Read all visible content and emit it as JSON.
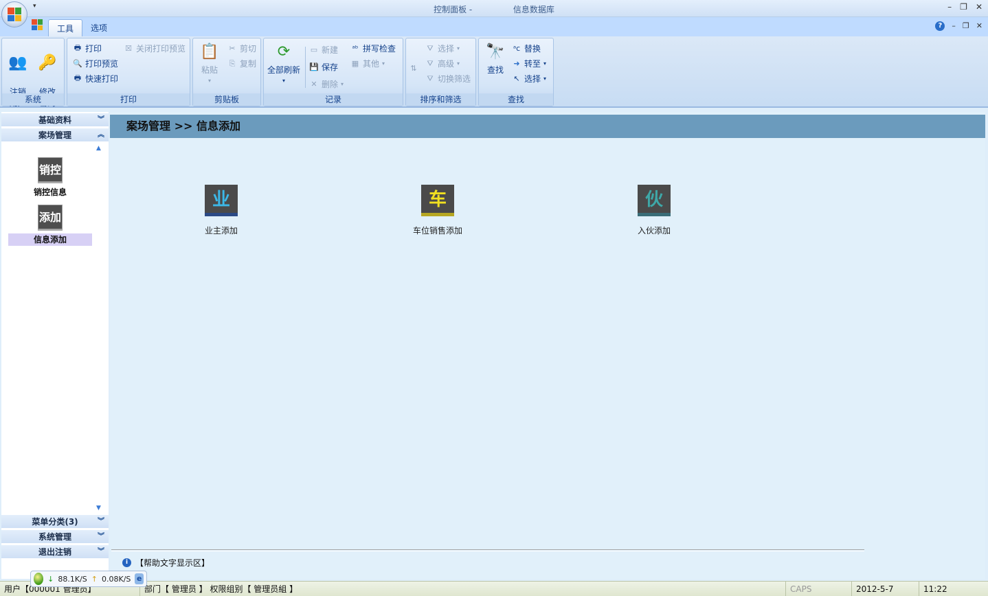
{
  "window": {
    "title_prefix": "控制面板 -",
    "title_suffix": "信息数据库",
    "controls": {
      "minimize": "–",
      "restore": "❐",
      "close": "✕"
    }
  },
  "tabs": [
    {
      "label": "工具",
      "active": true
    },
    {
      "label": "选项",
      "active": false
    }
  ],
  "ribbon": {
    "groups": {
      "system": {
        "label": "系统",
        "logout": "注销\n用户",
        "change_password": "修改\n密码"
      },
      "print": {
        "label": "打印",
        "print": "打印",
        "print_preview": "打印预览",
        "quick_print": "快速打印",
        "close_preview": "关闭打印预览"
      },
      "clipboard": {
        "label": "剪贴板",
        "paste": "粘贴",
        "cut": "剪切",
        "copy": "复制"
      },
      "records": {
        "label": "记录",
        "refresh_all": "全部刷新",
        "new": "新建",
        "save": "保存",
        "delete": "删除",
        "spell_check": "拼写检查",
        "other": "其他"
      },
      "sort_filter": {
        "label": "排序和筛选",
        "select": "选择",
        "advanced": "高级",
        "toggle_filter": "切换筛选"
      },
      "find": {
        "label": "查找",
        "find": "查找",
        "replace": "替换",
        "goto": "转至",
        "select": "选择"
      }
    }
  },
  "nav": {
    "headers_top": [
      {
        "label": "基础资料",
        "chevron": "︾"
      },
      {
        "label": "案场管理",
        "chevron": "︽"
      }
    ],
    "items": [
      {
        "icon_text": "销控",
        "label": "销控信息",
        "selected": false
      },
      {
        "icon_text": "添加",
        "label": "信息添加",
        "selected": true
      }
    ],
    "headers_bottom": [
      {
        "label": "菜单分类(3)",
        "chevron": "︾"
      },
      {
        "label": "系统管理",
        "chevron": "︾"
      },
      {
        "label": "退出注销",
        "chevron": "︾"
      }
    ]
  },
  "main": {
    "breadcrumb": "案场管理 >> 信息添加",
    "tiles": [
      {
        "icon_text": "业",
        "label": "业主添加",
        "color": "#3cb8e8",
        "bar": "#2b4a86"
      },
      {
        "icon_text": "车",
        "label": "车位销售添加",
        "color": "#f0e020",
        "bar": "#b6a722"
      },
      {
        "icon_text": "伙",
        "label": "入伙添加",
        "color": "#3ea8a8",
        "bar": "#3a6d78"
      }
    ],
    "help_text": "【帮助文字显示区】"
  },
  "speed_widget": {
    "down": "88.1K/S",
    "up": "0.08K/S"
  },
  "status": {
    "user": "用户【000001 管理员】",
    "dept": "部门【 管理员 】 权限组别【 管理员組 】",
    "caps": "CAPS",
    "date": "2012-5-7",
    "time": "11:22"
  }
}
